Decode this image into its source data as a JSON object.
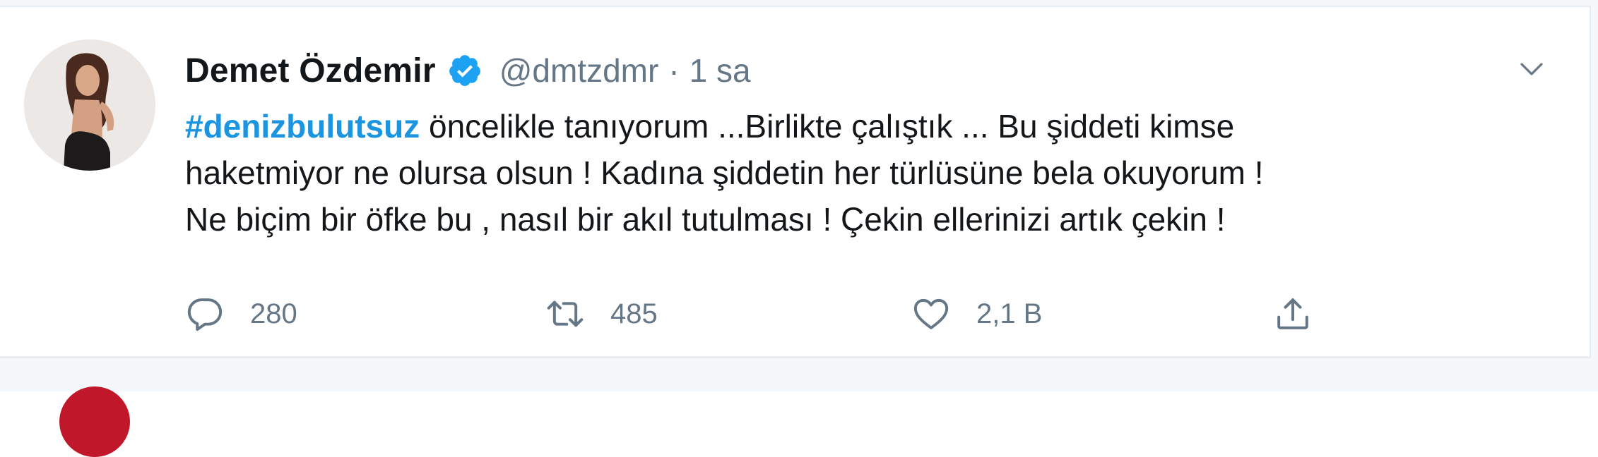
{
  "tweet": {
    "author_name": "Demet Özdemir",
    "handle": "@dmtzdmr",
    "separator": "·",
    "time": "1 sa",
    "text": {
      "hashtag": "#denizbulutsuz",
      "line1_rest": " öncelikle tanıyorum ...Birlikte çalıştık ... Bu şiddeti kimse",
      "line2": "haketmiyor ne olursa olsun ! Kadına şiddetin her türlüsüne bela okuyorum !",
      "line3": "Ne biçim bir öfke bu , nasıl bir akıl tutulması ! Çekin ellerinizi artık çekin !"
    },
    "actions": {
      "replies": "280",
      "retweets": "485",
      "likes": "2,1 B"
    }
  },
  "icons": {
    "verified": "verified-badge-icon",
    "caret": "chevron-down-icon",
    "reply": "reply-bubble-icon",
    "retweet": "retweet-icon",
    "like": "heart-icon",
    "share": "share-upload-icon"
  },
  "colors": {
    "link": "#1b95e0",
    "secondary_text": "#657786",
    "verified": "#1da1f2",
    "border": "#e6ecf0"
  }
}
